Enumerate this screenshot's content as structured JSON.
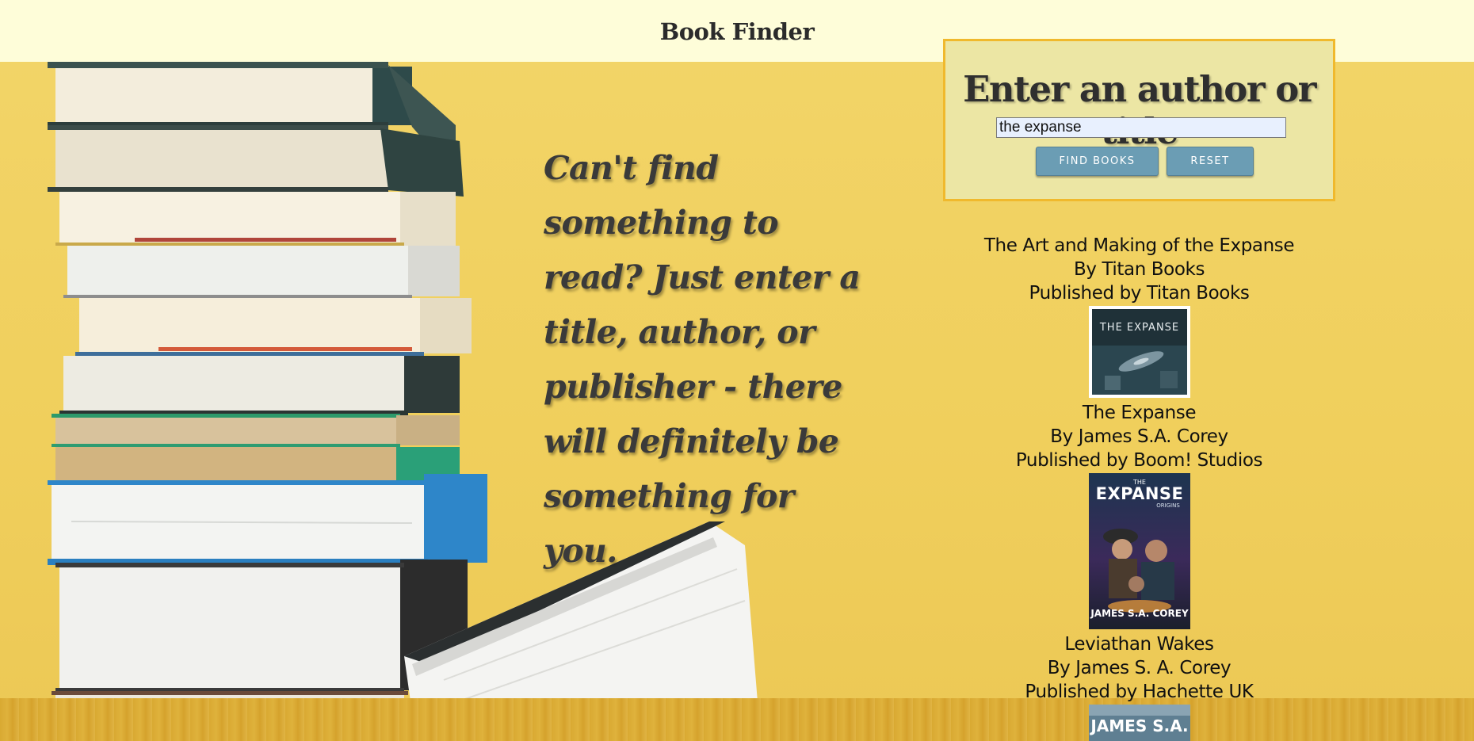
{
  "header": {
    "title": "Book Finder"
  },
  "tagline": "Can't find something to read? Just enter a title, author, or publisher - there will definitely be something for you.",
  "search": {
    "heading": "Enter an author or title",
    "value": "the expanse",
    "find_label": "FIND BOOKS",
    "reset_label": "RESET"
  },
  "results": [
    {
      "title": "The Art and Making of the Expanse",
      "author_line": "By Titan Books",
      "publisher_line": "Published by Titan Books",
      "cover_text": "THE EXPANSE",
      "cover_icon": "spaceship-cover-icon"
    },
    {
      "title": "The Expanse",
      "author_line": "By James S.A. Corey",
      "publisher_line": "Published by Boom! Studios",
      "cover_text_top": "THE",
      "cover_text_main": "EXPANSE",
      "cover_text_sub": "ORIGINS",
      "cover_text_author": "JAMES S.A. COREY",
      "cover_icon": "crew-cover-icon"
    },
    {
      "title": "Leviathan Wakes",
      "author_line": "By James S. A. Corey",
      "publisher_line": "Published by Hachette UK",
      "cover_text": "JAMES S.A.",
      "cover_icon": "novel-cover-icon"
    }
  ],
  "colors": {
    "header_bg": "#fefdd9",
    "page_bg": "#f2d160",
    "panel_bg": "#ece6a4",
    "panel_border": "#f0b92d",
    "button_bg": "#6b9db4"
  }
}
